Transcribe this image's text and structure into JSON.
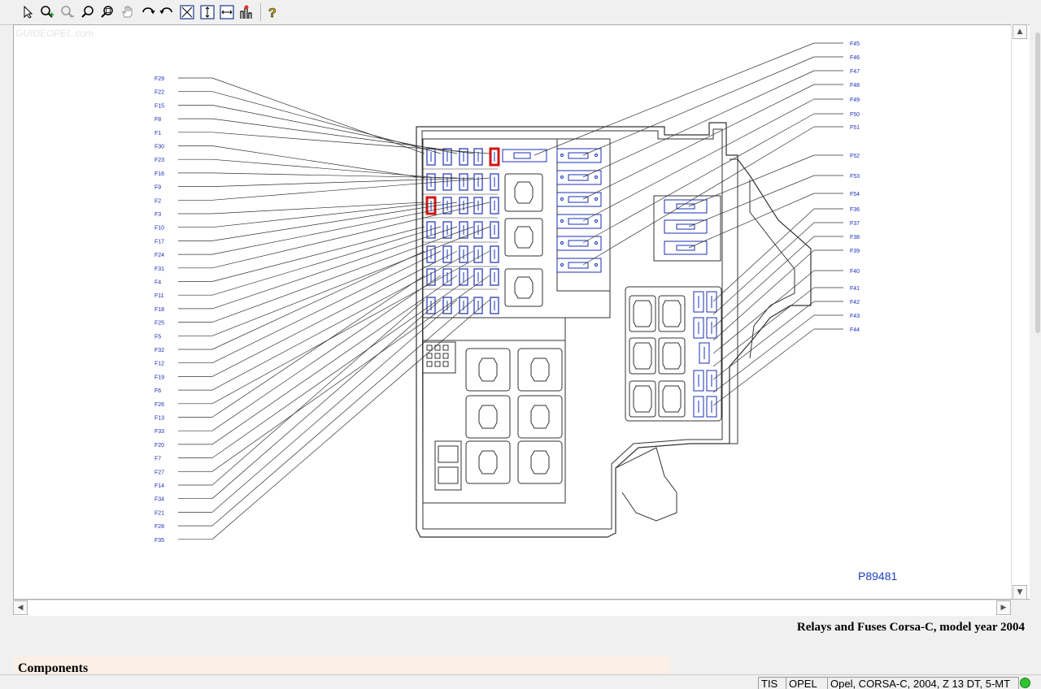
{
  "toolbar": {
    "icons": [
      "select-pointer",
      "zoom-in",
      "zoom-out",
      "zoom",
      "zoom-window",
      "pan-hand",
      "rotate-left",
      "rotate-right",
      "fit-window",
      "fit-height",
      "fit-width",
      "highlight",
      "help"
    ]
  },
  "watermark": "GUIDEOPEL.com",
  "diagram": {
    "left_labels": [
      "F29",
      "F22",
      "F15",
      "F8",
      "F1",
      "F30",
      "F23",
      "F16",
      "F9",
      "F2",
      "F3",
      "F10",
      "F17",
      "F24",
      "F31",
      "F4",
      "F11",
      "F18",
      "F25",
      "F5",
      "F32",
      "F12",
      "F19",
      "F6",
      "F26",
      "F13",
      "F33",
      "F20",
      "F7",
      "F27",
      "F14",
      "F34",
      "F21",
      "F28",
      "F35"
    ],
    "right_labels": [
      "F45",
      "F46",
      "F47",
      "F48",
      "F49",
      "F50",
      "F51",
      "F52",
      "F53",
      "F54",
      "F36",
      "F37",
      "F38",
      "F39",
      "F40",
      "F41",
      "F42",
      "F43",
      "F44"
    ],
    "reference": "P89481",
    "line_color": "#333333",
    "fuse_color": "#1a2fb4",
    "highlight_color": "#d41414"
  },
  "document": {
    "title": "Relays and Fuses Corsa-C, model year 2004",
    "section": "Components"
  },
  "statusbar": {
    "app": "TIS",
    "brand": "OPEL",
    "vehicle": "Opel, CORSA-C, 2004, Z 13 DT, 5-MT"
  }
}
